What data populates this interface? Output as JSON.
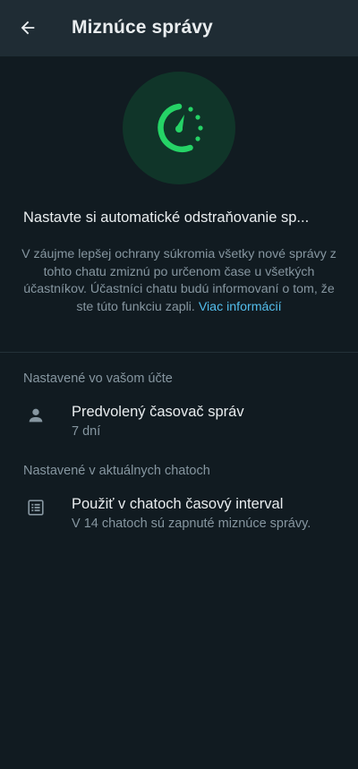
{
  "appbar": {
    "title": "Miznúce správy"
  },
  "hero": {
    "heading": "Nastavte si automatické odstraňovanie sp...",
    "description": "V záujme lepšej ochrany súkromia všetky nové správy z tohto chatu zmiznú po určenom čase u všetkých účastníkov. Účastníci chatu budú informovaní o tom, že ste túto funkciu zapli. ",
    "link": "Viac informácií"
  },
  "account_section": {
    "label": "Nastavené vo vašom účte",
    "item": {
      "title": "Predvolený časovač správ",
      "subtitle": "7 dní"
    }
  },
  "chats_section": {
    "label": "Nastavené v aktuálnych chatoch",
    "item": {
      "title": "Použiť v chatoch časový interval",
      "subtitle": "V 14 chatoch sú zapnuté miznúce správy."
    }
  },
  "colors": {
    "background": "#111b21",
    "appbar": "#1f2c34",
    "accent": "#00a884",
    "link": "#53bdeb",
    "secondary_text": "#8696a0"
  },
  "icons": {
    "back": "arrow-left-icon",
    "hero": "timer-icon",
    "account_item": "person-icon",
    "chats_item": "list-icon"
  }
}
